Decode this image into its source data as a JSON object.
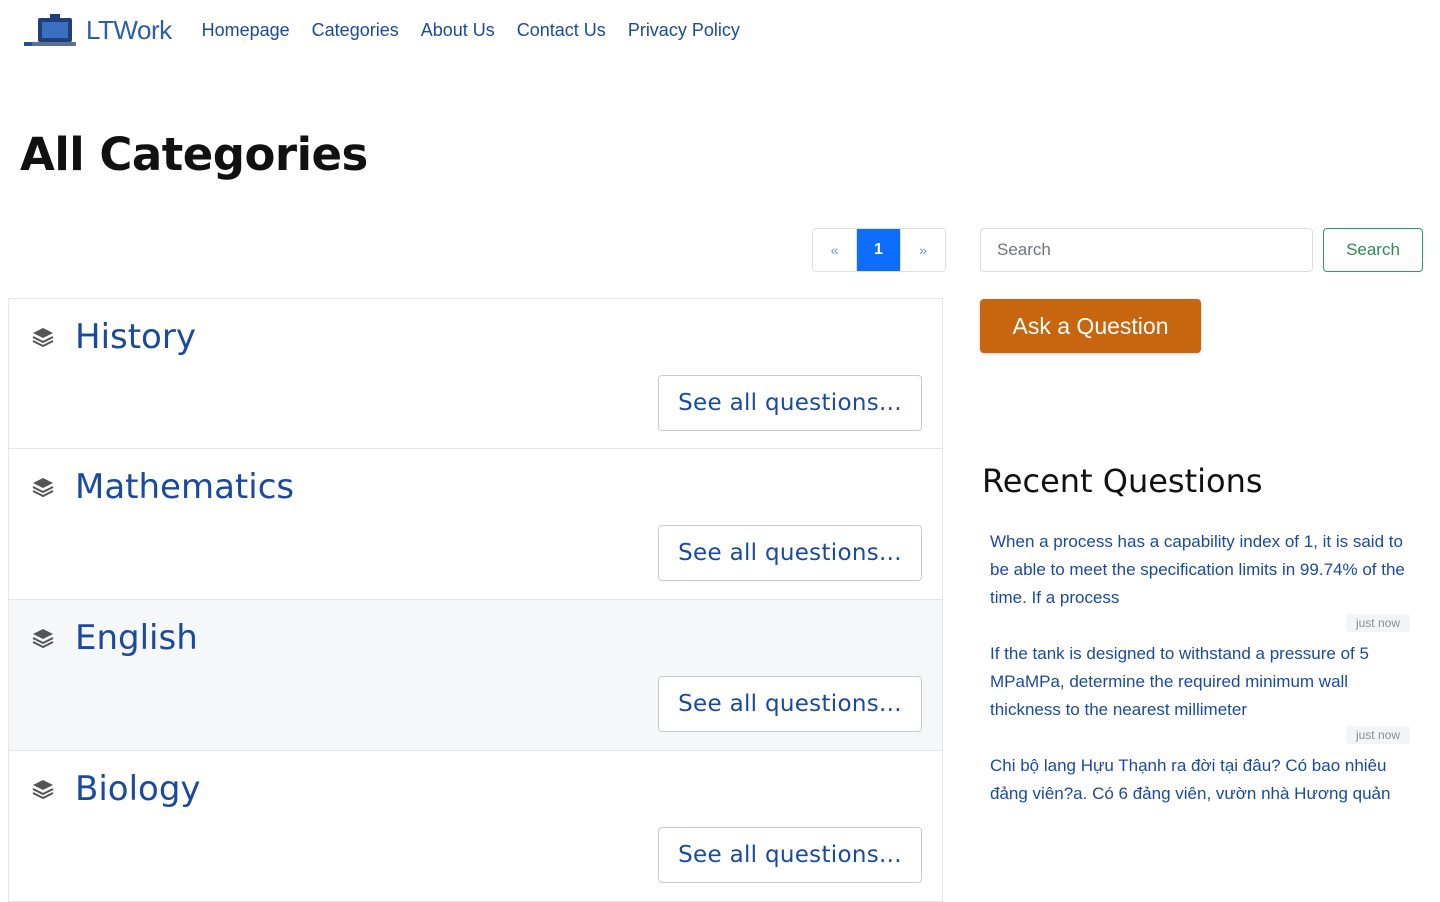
{
  "header": {
    "brand": "LTWork",
    "nav": [
      "Homepage",
      "Categories",
      "About Us",
      "Contact Us",
      "Privacy Policy"
    ]
  },
  "page": {
    "title": "All Categories"
  },
  "pagination": {
    "prev": "«",
    "current": "1",
    "next": "»"
  },
  "categories": [
    {
      "name": "History",
      "link": "See all questions..."
    },
    {
      "name": "Mathematics",
      "link": "See all questions..."
    },
    {
      "name": "English",
      "link": "See all questions..."
    },
    {
      "name": "Biology",
      "link": "See all questions..."
    }
  ],
  "sidebar": {
    "search_placeholder": "Search",
    "search_button": "Search",
    "ask_button": "Ask a Question",
    "recent_title": "Recent Questions",
    "recent": [
      {
        "text": "When a process has a capability index of 1, it is said to be able to meet the specification limits in 99.74% of the time. If a process",
        "time": "just now"
      },
      {
        "text": "If the tank is designed to withstand a pressure of 5 MPaMPa, determine the required minimum wall thickness to the nearest millimeter",
        "time": "just now"
      },
      {
        "text": "Chi bộ lang Hựu Thạnh ra đời tại đâu? Có bao nhiêu đảng viên?a. Có 6 đảng viên, vườn nhà Hương quản",
        "time": ""
      }
    ]
  },
  "colors": {
    "primary": "#0d6efd",
    "link": "#1a4aa0",
    "ask": "#c8650f",
    "search": "#2e8b57"
  }
}
